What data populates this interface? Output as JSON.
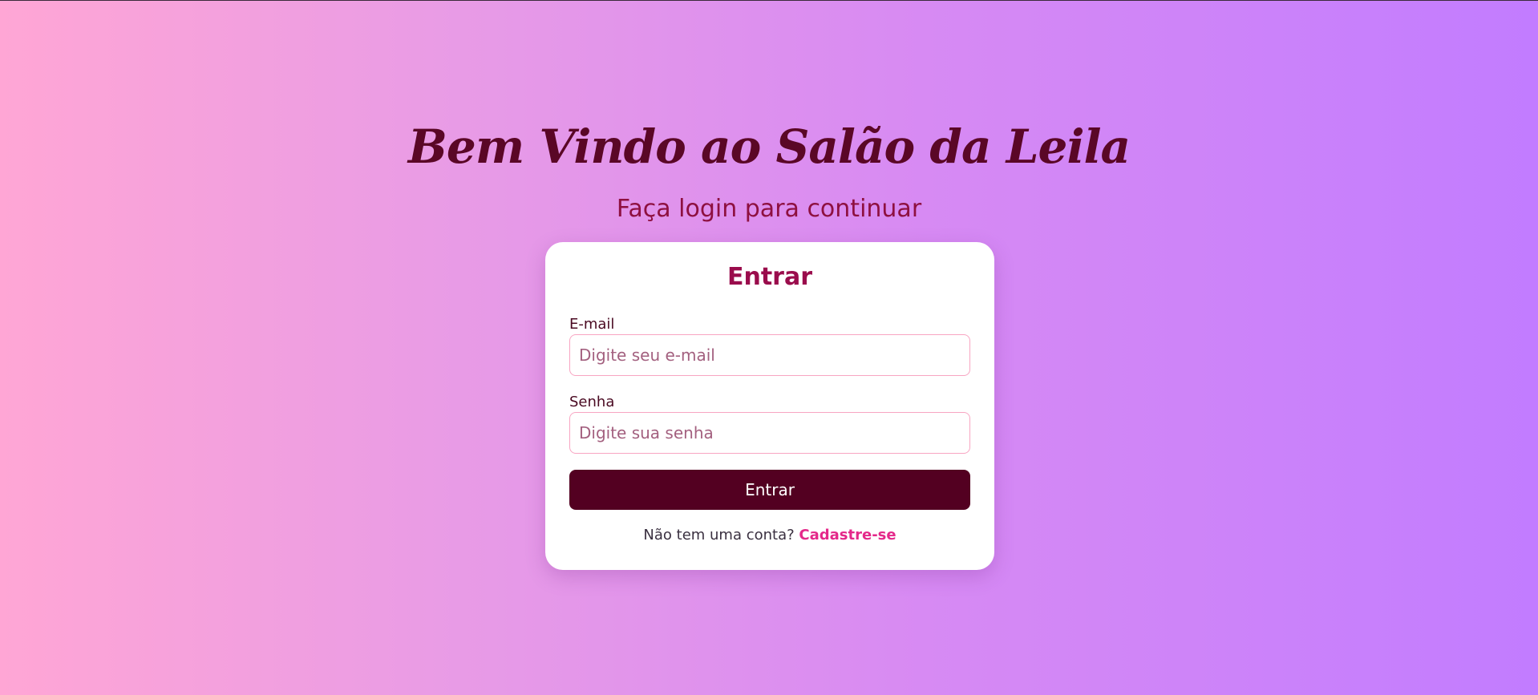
{
  "header": {
    "title": "Bem Vindo ao Salão da Leila",
    "subtitle": "Faça login para continuar"
  },
  "login": {
    "title": "Entrar",
    "email_label": "E-mail",
    "email_placeholder": "Digite seu e-mail",
    "password_label": "Senha",
    "password_placeholder": "Digite sua senha",
    "submit_label": "Entrar",
    "signup_prompt": "Não tem uma conta?",
    "signup_link": "Cadastre-se"
  },
  "colors": {
    "gradient_start": "#ffa6d5",
    "gradient_end": "#c27cff",
    "title": "#5a0726",
    "accent": "#9a0c4c",
    "button": "#530021",
    "link": "#e4288a",
    "input_border": "#f8a5c2"
  }
}
